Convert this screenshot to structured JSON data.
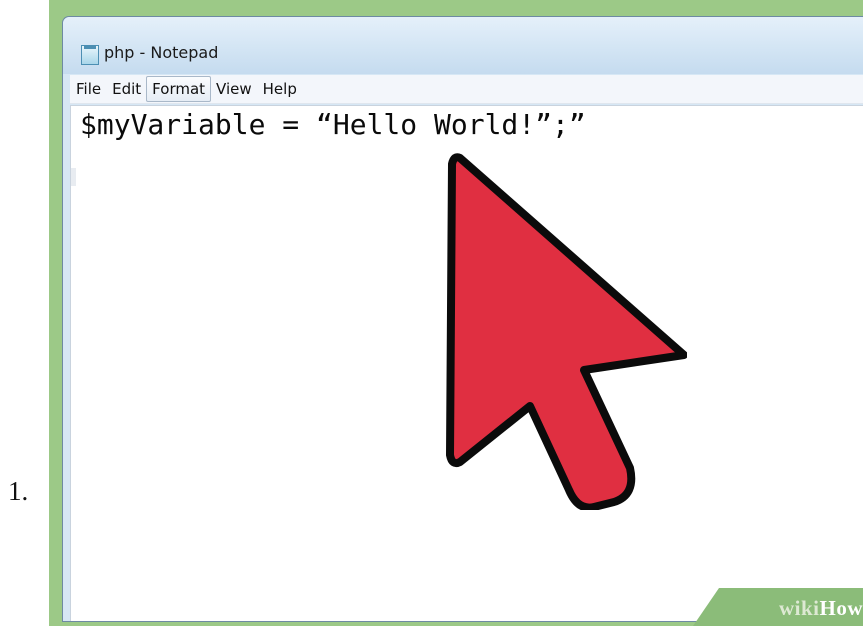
{
  "list": {
    "number": "1."
  },
  "window": {
    "title": "php - Notepad",
    "icon": "notepad-icon"
  },
  "menu": {
    "items": [
      {
        "label": "File"
      },
      {
        "label": "Edit"
      },
      {
        "label": "Format"
      },
      {
        "label": "View"
      },
      {
        "label": "Help"
      }
    ]
  },
  "editor": {
    "content": "$myVariable = “Hello World!”;”"
  },
  "overlay": {
    "icon": "mouse-pointer-icon",
    "color": "#e02f41"
  },
  "watermark": {
    "wiki": "wiki",
    "how": "How"
  },
  "colors": {
    "frame": "#9cc987",
    "titlebar": "#d6e7f5",
    "pointer": "#e02f41"
  }
}
